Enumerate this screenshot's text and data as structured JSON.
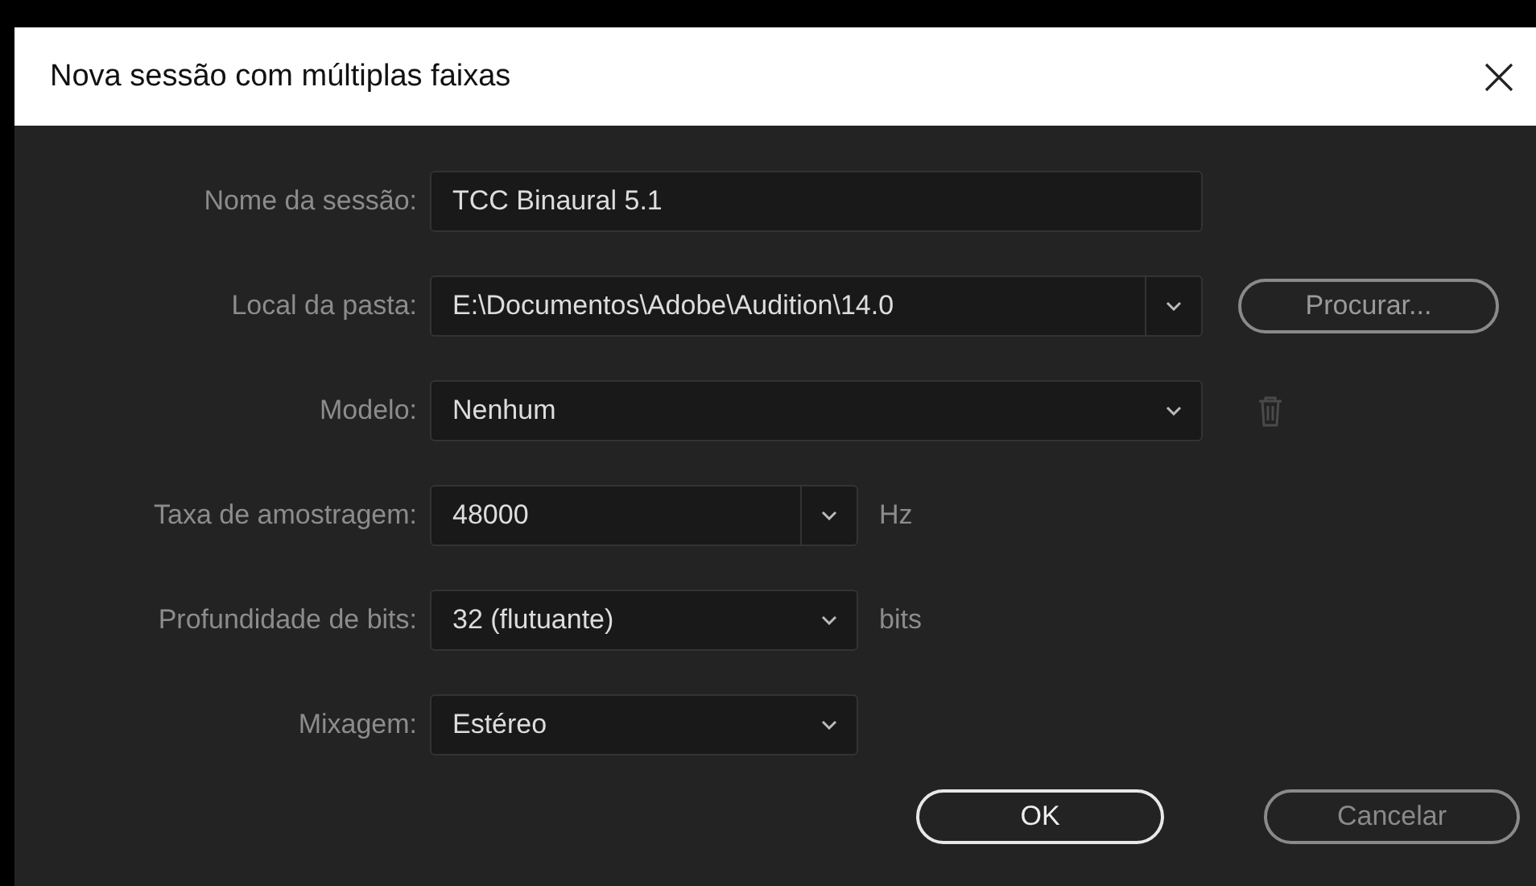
{
  "window": {
    "title": "Nova sessão com múltiplas faixas"
  },
  "fields": [
    {
      "kind": "text",
      "label": "Nome da sessão:",
      "value": "TCC Binaural 5.1"
    },
    {
      "kind": "combo",
      "label": "Local da pasta:",
      "value": "E:\\Documentos\\Adobe\\Audition\\14.0",
      "button": "Procurar..."
    },
    {
      "kind": "dropdown",
      "label": "Modelo:",
      "value": "Nenhum",
      "trash": true
    },
    {
      "kind": "combo",
      "label": "Taxa de amostragem:",
      "value": "48000",
      "unit": "Hz"
    },
    {
      "kind": "dropdown",
      "label": "Profundidade de bits:",
      "value": "32 (flutuante)",
      "unit": "bits"
    },
    {
      "kind": "dropdown",
      "label": "Mixagem:",
      "value": "Estéreo"
    }
  ],
  "buttons": [
    {
      "label": "OK",
      "primary": true
    },
    {
      "label": "Cancelar",
      "primary": false
    }
  ]
}
